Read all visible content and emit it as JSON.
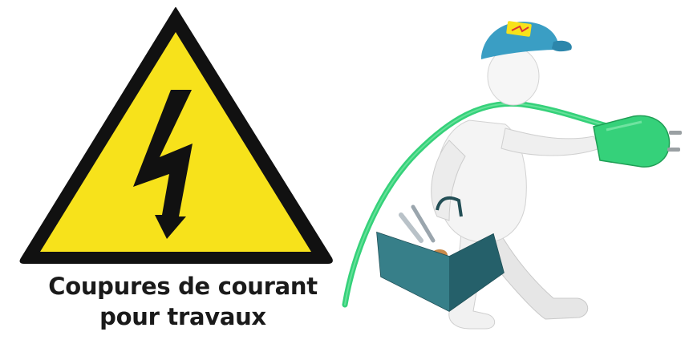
{
  "caption": {
    "line1": "Coupures de courant",
    "line2": "pour travaux"
  },
  "illustration": {
    "sign_icon": "high-voltage-warning-icon",
    "worker_icon": "electrician-worker-icon",
    "colors": {
      "sign_fill": "#f7e21b",
      "sign_border": "#111111",
      "cap": "#3a9ec4",
      "cable": "#35d17a",
      "toolbox": "#2e6f78"
    }
  }
}
